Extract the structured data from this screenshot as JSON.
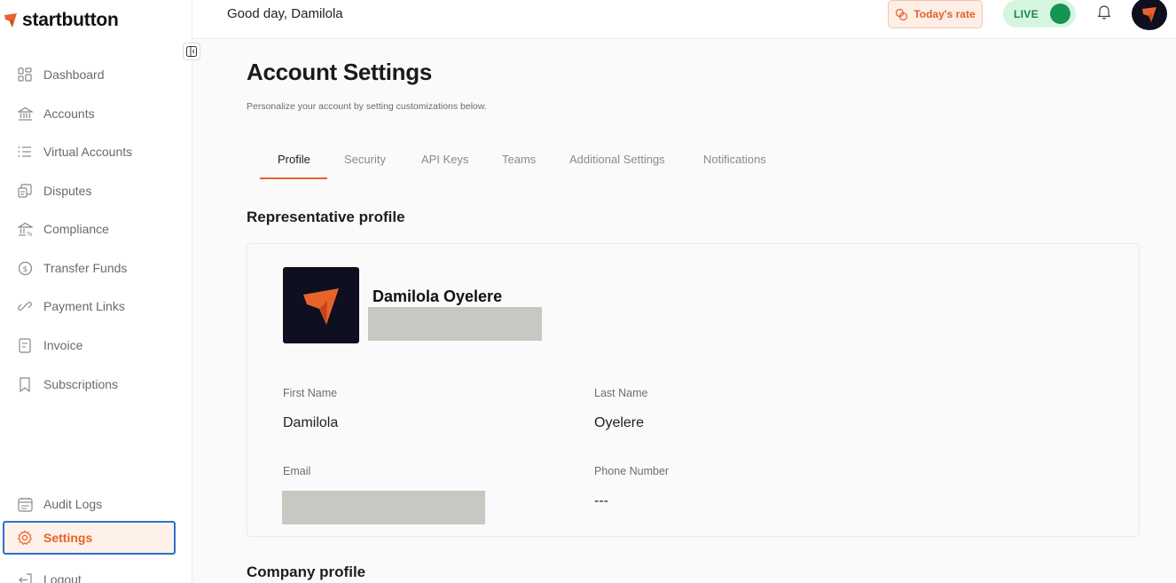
{
  "brand": {
    "name": "startbutton",
    "accent": "#e8632b"
  },
  "sidebar": {
    "items": [
      {
        "label": "Dashboard",
        "icon": "grid-icon"
      },
      {
        "label": "Accounts",
        "icon": "bank-icon"
      },
      {
        "label": "Virtual Accounts",
        "icon": "list-icon"
      },
      {
        "label": "Disputes",
        "icon": "disputes-icon"
      },
      {
        "label": "Compliance",
        "icon": "compliance-icon"
      },
      {
        "label": "Transfer Funds",
        "icon": "dollar-circle-icon"
      },
      {
        "label": "Payment Links",
        "icon": "link-icon"
      },
      {
        "label": "Invoice",
        "icon": "invoice-icon"
      },
      {
        "label": "Subscriptions",
        "icon": "bookmark-icon"
      }
    ],
    "bottom_items": [
      {
        "label": "Audit Logs",
        "icon": "calendar-icon"
      },
      {
        "label": "Settings",
        "icon": "gear-icon",
        "active": true
      },
      {
        "label": "Logout",
        "icon": "logout-icon"
      }
    ]
  },
  "header": {
    "greeting": "Good day, Damilola",
    "rate_label": "Today's rate",
    "live_label": "LIVE",
    "live_enabled": true
  },
  "page": {
    "title": "Account Settings",
    "subtitle": "Personalize your account by setting customizations below."
  },
  "tabs": [
    {
      "label": "Profile",
      "active": true
    },
    {
      "label": "Security"
    },
    {
      "label": "API Keys"
    },
    {
      "label": "Teams"
    },
    {
      "label": "Additional Settings"
    },
    {
      "label": "Notifications"
    }
  ],
  "representative": {
    "section_title": "Representative profile",
    "name": "Damilola Oyelere",
    "first_name_label": "First Name",
    "first_name": "Damilola",
    "last_name_label": "Last Name",
    "last_name": "Oyelere",
    "email_label": "Email",
    "phone_label": "Phone Number",
    "phone": "---"
  },
  "company": {
    "section_title": "Company profile"
  }
}
